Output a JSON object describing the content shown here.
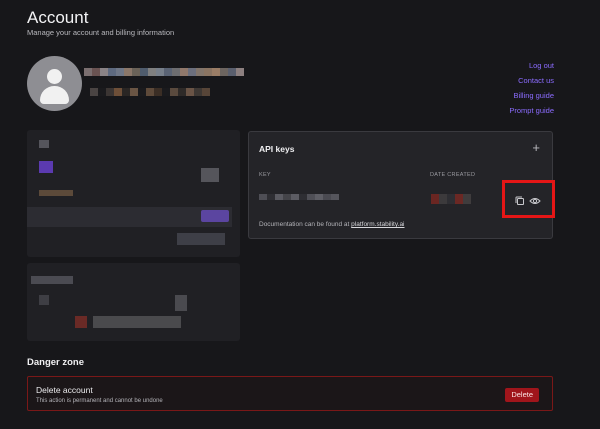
{
  "header": {
    "title": "Account",
    "subtitle": "Manage your account and billing information"
  },
  "links": [
    "Log out",
    "Contact us",
    "Billing guide",
    "Prompt guide"
  ],
  "api_keys": {
    "title": "API keys",
    "add_icon": "+",
    "col_key": "KEY",
    "col_date": "DATE CREATED",
    "doc_prefix": "Documentation can be found at ",
    "doc_link": "platform.stability.ai"
  },
  "danger": {
    "title": "Danger zone",
    "heading": "Delete account",
    "sub": "This action is permanent and cannot be undone",
    "button": "Delete"
  },
  "colors": {
    "background": "#17171a",
    "accent": "#8b6cff",
    "danger": "#a0151b",
    "highlight_box": "#e51616"
  }
}
